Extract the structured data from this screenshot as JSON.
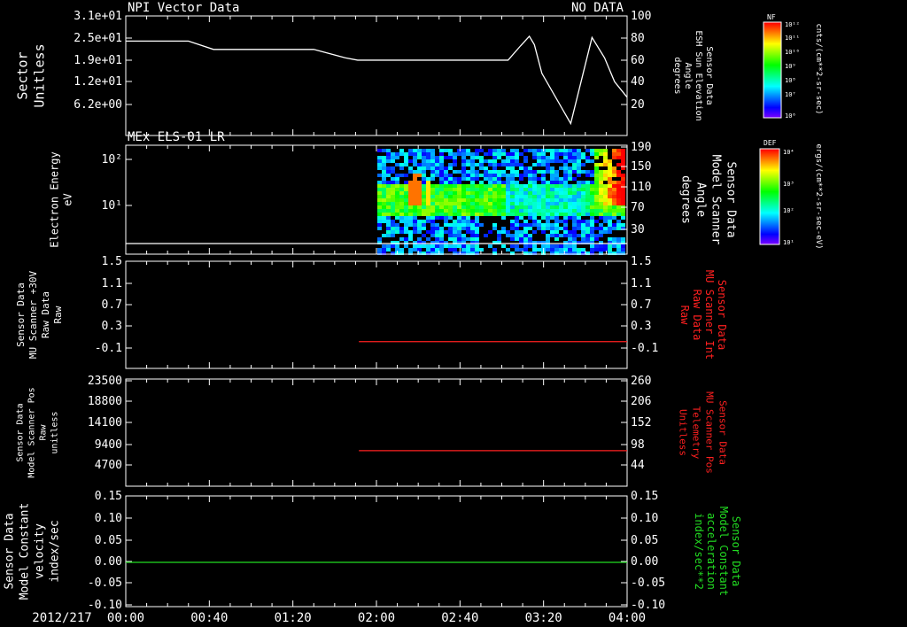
{
  "colors": {
    "background": "#000000",
    "axis": "#ffffff",
    "red": "#ff2020",
    "green": "#22dd22"
  },
  "time_axis": {
    "date_label": "2012/217",
    "ticks": [
      "00:00",
      "00:40",
      "01:20",
      "02:00",
      "02:40",
      "03:20",
      "04:00"
    ],
    "range_hours": [
      0,
      4
    ]
  },
  "chart_data": [
    {
      "id": "panel1",
      "type": "line",
      "title": "NPI Vector Data",
      "status": "NO DATA",
      "left_label": [
        "Sector",
        "Unitless"
      ],
      "left_ticks": [
        "3.1e+01",
        "2.5e+01",
        "1.9e+01",
        "1.2e+01",
        "6.2e+00"
      ],
      "right_label": [
        "Sensor Data",
        "ESH Sun Elevation",
        "Angle",
        "degrees"
      ],
      "right_ticks": [
        "100",
        "80",
        "60",
        "40",
        "20"
      ],
      "ylim": [
        0,
        100
      ],
      "series": [
        {
          "color": "white",
          "x": [
            0,
            0.15,
            0.5,
            0.7,
            1.5,
            1.75,
            1.85,
            2.0,
            3.05,
            3.15,
            3.22,
            3.26,
            3.32,
            3.55,
            3.72,
            3.82,
            3.9,
            4.0
          ],
          "y": [
            79,
            79,
            79,
            72,
            72,
            65,
            63,
            63,
            63,
            75,
            83,
            76,
            52,
            10,
            82,
            65,
            45,
            32
          ]
        }
      ]
    },
    {
      "id": "panel2",
      "type": "heatmap",
      "title": "MEx ELS-01 LR",
      "left_label": [
        "Electron Energy",
        "eV"
      ],
      "left_ticks": [
        "10²",
        "10¹"
      ],
      "right_label": [
        "Sensor Data",
        "Model Scanner",
        "Angle",
        "degrees"
      ],
      "right_ticks": [
        "190",
        "150",
        "110",
        "70",
        "30"
      ],
      "colorbar": {
        "label": "DEF",
        "top": "10⁴",
        "mid1": "10³",
        "mid2": "10²",
        "bottom": "10¹",
        "units": "ergs/(cm**2-sr-sec-eV)"
      },
      "series": [
        {
          "color": "white",
          "x": [
            0,
            4
          ],
          "y": [
            5,
            5
          ]
        }
      ]
    },
    {
      "id": "panel3",
      "type": "line",
      "left_label": [
        "Sensor Data",
        "MU Scanner +30V",
        "Raw Data",
        "Raw"
      ],
      "left_ticks": [
        "1.5",
        "1.1",
        "0.7",
        "0.3",
        "-0.1"
      ],
      "right_label": [
        "Sensor Data",
        "MU Scanner Int",
        "Raw Data",
        "Raw"
      ],
      "right_ticks": [
        "1.5",
        "1.1",
        "0.7",
        "0.3",
        "-0.1"
      ],
      "ylim": [
        -0.5,
        1.5
      ],
      "series": [
        {
          "color": "red",
          "x": [
            1.86,
            4.0
          ],
          "y": [
            0.0,
            0.0
          ]
        }
      ]
    },
    {
      "id": "panel4",
      "type": "line",
      "left_label": [
        "Sensor Data",
        "Model Scanner Pos",
        "Raw",
        "unitless"
      ],
      "left_ticks": [
        "23500",
        "18800",
        "14100",
        "9400",
        "4700"
      ],
      "right_label": [
        "Sensor Data",
        "MU Scanner Pos",
        "Telemetry",
        "Unitless"
      ],
      "right_ticks": [
        "260",
        "206",
        "152",
        "98",
        "44"
      ],
      "ylim": [
        0,
        23500
      ],
      "series": [
        {
          "color": "red",
          "x": [
            1.86,
            4.0
          ],
          "y": [
            7800,
            7800
          ]
        }
      ]
    },
    {
      "id": "panel5",
      "type": "line",
      "left_label": [
        "Sensor Data",
        "Model Constant",
        "velocity",
        "index/sec"
      ],
      "left_ticks": [
        "0.15",
        "0.10",
        "0.05",
        "0.00",
        "-0.05",
        "-0.10"
      ],
      "right_label": [
        "Sensor Data",
        "Model Constant",
        "acceleration",
        "index/sec**2"
      ],
      "right_ticks": [
        "0.15",
        "0.10",
        "0.05",
        "0.00",
        "-0.05",
        "-0.10"
      ],
      "ylim": [
        -0.1,
        0.15
      ],
      "series": [
        {
          "color": "green",
          "x": [
            0,
            4
          ],
          "y": [
            0,
            0
          ]
        }
      ]
    }
  ],
  "top_colorbar": {
    "label": "NF",
    "top": "10¹²",
    "ticks": [
      "10¹¹",
      "10¹⁰",
      "10⁹",
      "10⁸",
      "10⁷"
    ],
    "bottom": "10⁶",
    "units": "cnts/(cm**2-sr-sec)"
  }
}
